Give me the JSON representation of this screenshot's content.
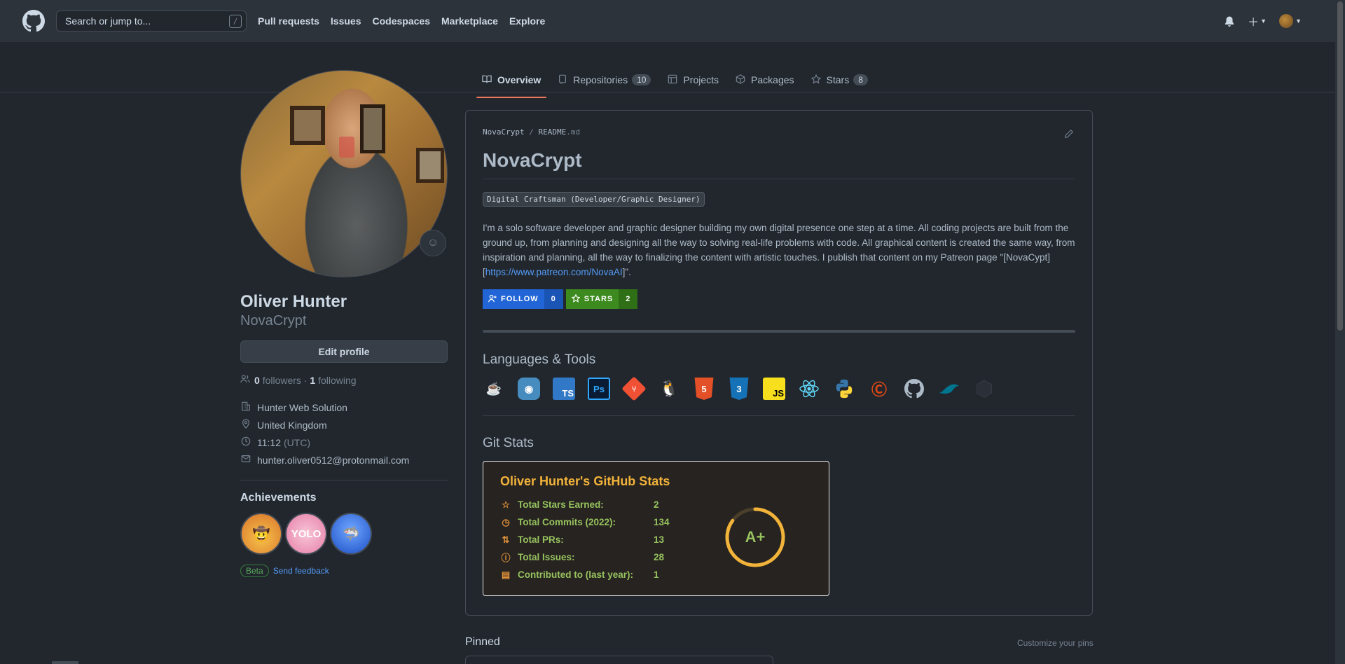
{
  "header": {
    "search_placeholder": "Search or jump to...",
    "search_key": "/",
    "nav": [
      "Pull requests",
      "Issues",
      "Codespaces",
      "Marketplace",
      "Explore"
    ]
  },
  "tabs": [
    {
      "label": "Overview",
      "icon": "book-icon",
      "active": true
    },
    {
      "label": "Repositories",
      "icon": "repo-icon",
      "count": "10"
    },
    {
      "label": "Projects",
      "icon": "table-icon"
    },
    {
      "label": "Packages",
      "icon": "package-icon"
    },
    {
      "label": "Stars",
      "icon": "star-icon",
      "count": "8"
    }
  ],
  "profile": {
    "full_name": "Oliver Hunter",
    "username": "NovaCrypt",
    "edit_label": "Edit profile",
    "followers_count": "0",
    "followers_label": "followers",
    "following_count": "1",
    "following_label": "following",
    "company": "Hunter Web Solution",
    "location": "United Kingdom",
    "time": "11:12",
    "timezone": "(UTC)",
    "email": "hunter.oliver0512@protonmail.com",
    "achievements_title": "Achievements",
    "beta_label": "Beta",
    "feedback_label": "Send feedback"
  },
  "readme": {
    "crumb_user": "NovaCrypt",
    "crumb_sep": "/",
    "crumb_file": "README",
    "crumb_ext": ".md",
    "title": "NovaCrypt",
    "role": "Digital Craftsman (Developer/Graphic Designer)",
    "bio_text": "I'm a solo software developer and graphic designer building my own digital presence one step at a time. All coding projects are built from the ground up, from planning and designing all the way to solving real-life problems with code. All graphical content is created the same way, from inspiration and planning, all the way to finalizing the content with artistic touches. I publish that content on my Patreon page \"[NovaCypt][",
    "bio_link": "https://www.patreon.com/NovaAI",
    "bio_end": "]\".",
    "follow_label": "FOLLOW",
    "follow_count": "0",
    "stars_label": "STARS",
    "stars_count": "2",
    "languages_title": "Languages & Tools",
    "tools": [
      "java-icon",
      "godot-icon",
      "typescript-icon",
      "photoshop-icon",
      "git-icon",
      "linux-icon",
      "html5-icon",
      "css3-icon",
      "javascript-icon",
      "react-icon",
      "python-icon",
      "codeigniter-icon",
      "github-icon",
      "mysql-icon",
      "unity-icon"
    ],
    "gitstats_title": "Git Stats"
  },
  "stats_card": {
    "title": "Oliver Hunter's GitHub Stats",
    "rows": [
      {
        "icon": "star-icon",
        "label": "Total Stars Earned:",
        "value": "2"
      },
      {
        "icon": "history-icon",
        "label": "Total Commits (2022):",
        "value": "134"
      },
      {
        "icon": "pull-request-icon",
        "label": "Total PRs:",
        "value": "13"
      },
      {
        "icon": "issue-icon",
        "label": "Total Issues:",
        "value": "28"
      },
      {
        "icon": "repo-icon",
        "label": "Contributed to (last year):",
        "value": "1"
      }
    ],
    "grade": "A+",
    "grade_progress": 0.85,
    "colors": {
      "title": "#f2b33a",
      "text": "#96c25e",
      "icon": "#e0913a",
      "bg": "#272320"
    }
  },
  "pinned": {
    "title": "Pinned",
    "customize": "Customize your pins"
  }
}
